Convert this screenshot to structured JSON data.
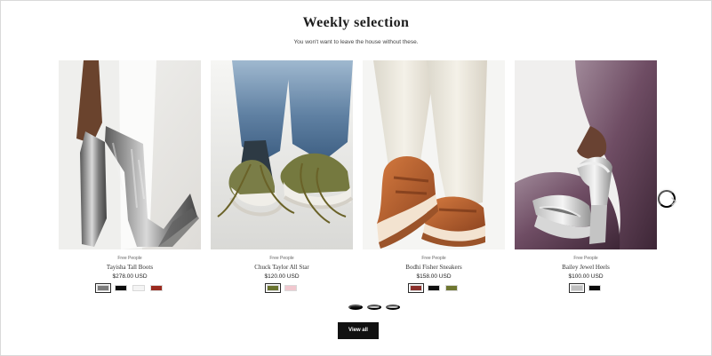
{
  "section": {
    "title": "Weekly selection",
    "subtitle": "You won't want to leave the house without these."
  },
  "products": [
    {
      "brand": "Free People",
      "name": "Tayisha Tall Boots",
      "price": "$278.00 USD",
      "swatches": [
        "#7c7c7c",
        "#0d0d0d",
        "#f4f4f4",
        "#9b2a1f"
      ]
    },
    {
      "brand": "Free People",
      "name": "Chuck Taylor All Star",
      "price": "$120.00 USD",
      "swatches": [
        "#69732f",
        "#f1c8cf"
      ]
    },
    {
      "brand": "Free People",
      "name": "Bodhi Fisher Sneakers",
      "price": "$158.00 USD",
      "swatches": [
        "#8a2f2a",
        "#111111",
        "#6f7730"
      ]
    },
    {
      "brand": "Free People",
      "name": "Bailey Jewel Heels",
      "price": "$100.00 USD",
      "swatches": [
        "#bfbfbf",
        "#0b0b0b"
      ]
    }
  ],
  "pagination": {
    "page_count": 3,
    "active_page": 1
  },
  "actions": {
    "view_all": "View all"
  },
  "icons": {
    "carousel_next": "chevron-right-icon",
    "pagination_dot": "dot-icon"
  },
  "colors": {
    "button_background": "#111111",
    "button_text": "#ffffff",
    "active_dot": "#111111",
    "inactive_dot": "#c8c8c8"
  }
}
